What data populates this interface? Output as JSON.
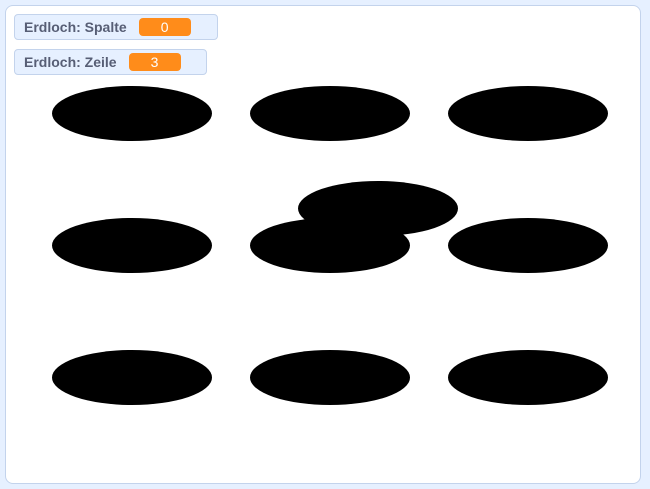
{
  "monitors": {
    "spalte": {
      "label": "Erdloch: Spalte",
      "value": "0"
    },
    "zeile": {
      "label": "Erdloch: Zeile",
      "value": "3"
    }
  },
  "holes": [
    {
      "name": "hole-r1-c1"
    },
    {
      "name": "hole-r1-c2"
    },
    {
      "name": "hole-r1-c3"
    },
    {
      "name": "hole-r2-c1"
    },
    {
      "name": "hole-r2-c2"
    },
    {
      "name": "hole-r2-c3"
    },
    {
      "name": "hole-r3-c1"
    },
    {
      "name": "hole-r3-c2"
    },
    {
      "name": "hole-r3-c3"
    },
    {
      "name": "mole-sprite"
    }
  ],
  "colors": {
    "stage_background": "#ffffff",
    "monitor_background": "#e6f0ff",
    "monitor_value_orange": "#ff8c1a",
    "label_text": "#575e75",
    "hole": "#000000"
  }
}
